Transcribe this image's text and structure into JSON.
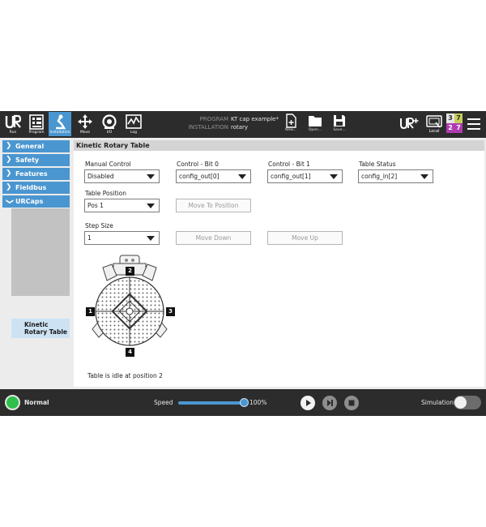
{
  "topbar": {
    "tabs": [
      {
        "label": "Run",
        "icon": "ur-logo-icon"
      },
      {
        "label": "Program",
        "icon": "program-icon"
      },
      {
        "label": "Installation",
        "icon": "installation-icon",
        "active": true
      },
      {
        "label": "Move",
        "icon": "move-icon"
      },
      {
        "label": "I/O",
        "icon": "io-icon"
      },
      {
        "label": "Log",
        "icon": "log-icon"
      }
    ],
    "program_key": "PROGRAM",
    "program_value": "KT cap example*",
    "installation_key": "INSTALLATION",
    "installation_value": "rotary",
    "file_buttons": [
      {
        "label": "New...",
        "icon": "new-file-icon"
      },
      {
        "label": "Open...",
        "icon": "open-folder-icon"
      },
      {
        "label": "Save...",
        "icon": "save-icon"
      }
    ],
    "local_label": "Local",
    "counter": {
      "top_left": "3",
      "top_right": "7",
      "bottom_left": "2",
      "bottom_right": "7"
    }
  },
  "leftnav": {
    "items": [
      "General",
      "Safety",
      "Features",
      "Fieldbus",
      "URCaps"
    ],
    "sub_item": "Kinetic Rotary Table"
  },
  "panel": {
    "title": "Kinetic Rotary Table",
    "manual_control": {
      "label": "Manual Control",
      "value": "Disabled"
    },
    "control_bit0": {
      "label": "Control - Bit 0",
      "value": "config_out[0]"
    },
    "control_bit1": {
      "label": "Control - Bit 1",
      "value": "config_out[1]"
    },
    "table_status": {
      "label": "Table Status",
      "value": "config_in[2]"
    },
    "table_position": {
      "label": "Table Position",
      "value": "Pos 1"
    },
    "move_to_position": "Move To Position",
    "step_size": {
      "label": "Step Size",
      "value": "1"
    },
    "move_down": "Move Down",
    "move_up": "Move Up",
    "position_markers": [
      "1",
      "2",
      "3",
      "4"
    ],
    "status_message": "Table is idle at position 2"
  },
  "bottombar": {
    "robot_status": "Normal",
    "speed_label": "Speed",
    "speed_value": "100%",
    "speed_fraction": 1.0,
    "simulation_label": "Simulation",
    "status_color": "#2ec04a",
    "accent_color": "#4a96d0"
  }
}
